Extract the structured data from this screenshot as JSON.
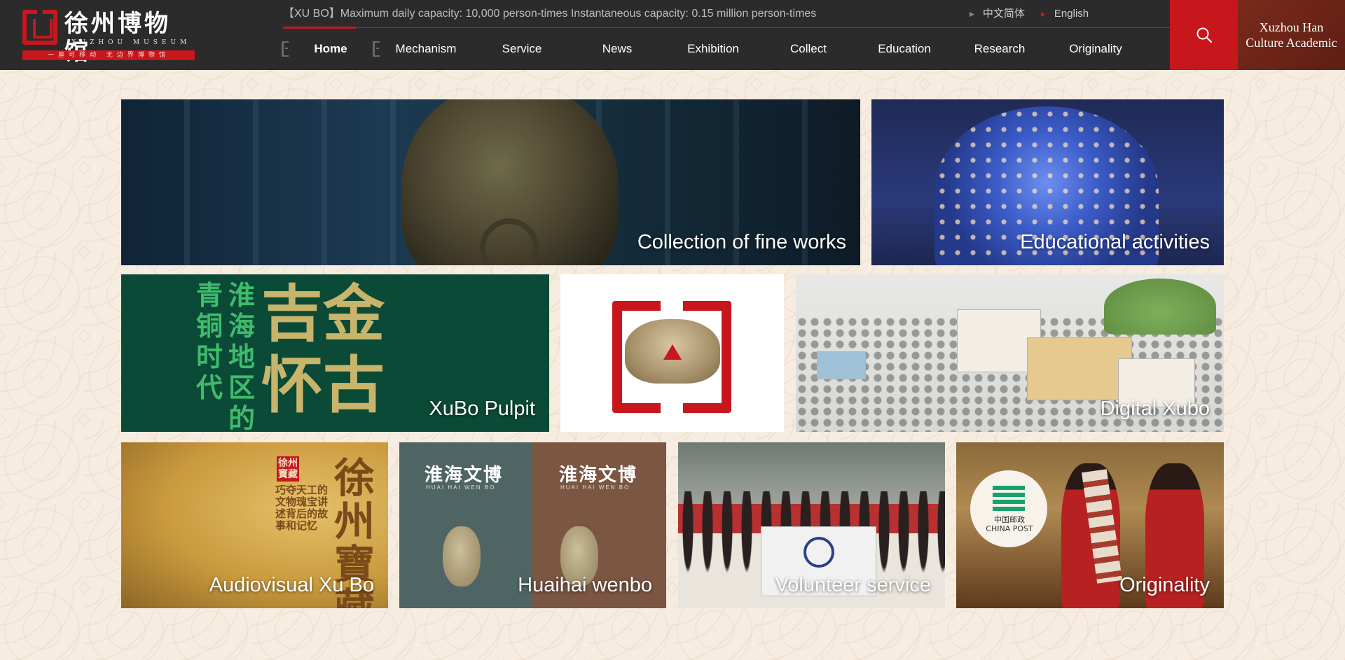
{
  "header": {
    "logo": {
      "cn": "徐州博物馆",
      "en": "XUZHOU MUSEUM",
      "tagline": "一座可移动 无边界博物馆"
    },
    "notice": "【XU BO】Maximum daily capacity: 10,000 person-times Instantaneous capacity: 0.15 million person-times",
    "languages": [
      {
        "label": "中文简体"
      },
      {
        "label": "English"
      }
    ],
    "nav": [
      {
        "label": "Home"
      },
      {
        "label": "Mechanism"
      },
      {
        "label": "Service"
      },
      {
        "label": "News"
      },
      {
        "label": "Exhibition"
      },
      {
        "label": "Collect"
      },
      {
        "label": "Education"
      },
      {
        "label": "Research"
      },
      {
        "label": "Originality"
      }
    ],
    "search_icon": "search-icon",
    "academic": {
      "line1": "Xuzhou Han",
      "line2": "Culture Academic"
    }
  },
  "tiles": {
    "collection": {
      "label": "Collection of fine works"
    },
    "education": {
      "label": "Educational activities"
    },
    "pulpit": {
      "label": "XuBo Pulpit",
      "cn_small": [
        "青铜时代",
        "淮海地区的"
      ],
      "cn_big": [
        "吉金",
        "怀古"
      ]
    },
    "digital": {
      "label": "Digital Xubo"
    },
    "audio": {
      "label": "Audiovisual Xu Bo",
      "cn_big": "徐州寶藏",
      "cn_small": "巧夺天工的文物瑰宝讲述背后的故事和记忆",
      "seal": "徐州寶藏"
    },
    "huaihai": {
      "label": "Huaihai wenbo",
      "book_title": "淮海文博",
      "book_sub": "HUAI HAI WEN BO"
    },
    "volunteer": {
      "label": "Volunteer service"
    },
    "originality": {
      "label": "Originality",
      "post_cn": "中国邮政",
      "post_en": "CHINA POST"
    }
  },
  "colors": {
    "header_bg": "#2b2b2b",
    "accent_red": "#c8161d",
    "page_bg": "#f6ece0"
  }
}
